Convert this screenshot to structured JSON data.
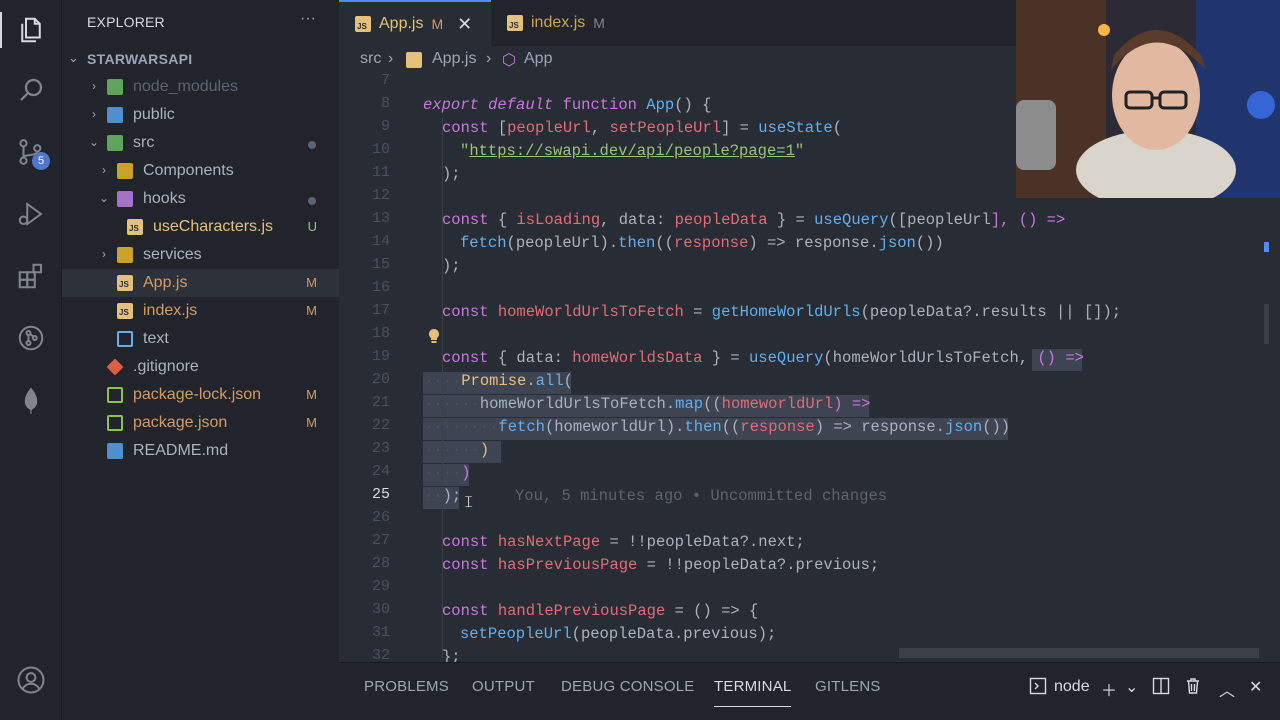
{
  "activity_bar": {
    "items": [
      {
        "icon": "files-icon"
      },
      {
        "icon": "search-icon"
      },
      {
        "icon": "source-control-icon",
        "badge": "5"
      },
      {
        "icon": "run-debug-icon"
      },
      {
        "icon": "extensions-icon"
      },
      {
        "icon": "gitlens-icon"
      },
      {
        "icon": "mongodb-leaf-icon"
      }
    ],
    "bottom": {
      "icon": "account-icon"
    }
  },
  "sidebar": {
    "title": "EXPLORER",
    "more": "···",
    "root": "STARWARSAPI",
    "tree": [
      {
        "name": "node_modules",
        "chevron": "›",
        "status": ""
      },
      {
        "name": "public",
        "chevron": "›",
        "status": ""
      },
      {
        "name": "src",
        "chevron": "⌄",
        "status": "dot"
      },
      {
        "name": "Components",
        "chevron": "›",
        "status": ""
      },
      {
        "name": "hooks",
        "chevron": "⌄",
        "status": "dot"
      },
      {
        "name": "useCharacters.js",
        "chevron": "",
        "status": "U"
      },
      {
        "name": "services",
        "chevron": "›",
        "status": ""
      },
      {
        "name": "App.js",
        "chevron": "",
        "status": "M"
      },
      {
        "name": "index.js",
        "chevron": "",
        "status": "M"
      },
      {
        "name": "text",
        "chevron": "",
        "status": ""
      },
      {
        "name": ".gitignore",
        "chevron": "",
        "status": ""
      },
      {
        "name": "package-lock.json",
        "chevron": "",
        "status": "M"
      },
      {
        "name": "package.json",
        "chevron": "",
        "status": "M"
      },
      {
        "name": "README.md",
        "chevron": "",
        "status": ""
      }
    ]
  },
  "tabs": [
    {
      "label": "App.js",
      "status": "M",
      "close": "✕",
      "active": true
    },
    {
      "label": "index.js",
      "status": "M",
      "active": false
    }
  ],
  "breadcrumb": {
    "part1": "src",
    "sep": "›",
    "part2": "App.js",
    "part3": "App"
  },
  "editor": {
    "line_numbers": [
      "7",
      "8",
      "9",
      "10",
      "11",
      "12",
      "13",
      "14",
      "15",
      "16",
      "17",
      "18",
      "19",
      "20",
      "21",
      "22",
      "23",
      "24",
      "25",
      "26",
      "27",
      "28",
      "29",
      "30",
      "31",
      "32"
    ],
    "current_line": "25",
    "blame": "You, 5 minutes ago • Uncommitted changes",
    "tokens": {
      "l8": [
        "export",
        " ",
        "default",
        " ",
        "function",
        " ",
        "App",
        "() {"
      ],
      "l9": [
        "const",
        " [",
        "peopleUrl",
        ", ",
        "setPeopleUrl",
        "] = ",
        "useState",
        "("
      ],
      "l10": [
        "\"",
        "https://swapi.dev/api/people?page=1",
        "\""
      ],
      "l11": [
        ");"
      ],
      "l13": [
        "const",
        " { ",
        "isLoading",
        ", ",
        "data",
        ": ",
        "peopleData",
        " } = ",
        "useQuery",
        "([",
        "peopleUrl",
        "], () =>"
      ],
      "l14": [
        "fetch",
        "(",
        "peopleUrl",
        ").",
        "then",
        "((",
        "response",
        ") => ",
        "response",
        ".",
        "json",
        "())"
      ],
      "l15": [
        ");"
      ],
      "l17": [
        "const",
        " ",
        "homeWorldUrlsToFetch",
        " = ",
        "getHomeWorldUrls",
        "(",
        "peopleData",
        "?.",
        "results",
        " || ",
        "[]",
        ");"
      ],
      "l19": [
        "const",
        " { ",
        "data",
        ": ",
        "homeWorldsData",
        " } = ",
        "useQuery",
        "(",
        "homeWorldUrlsToFetch",
        ", ",
        "() =>"
      ],
      "l20": [
        "····",
        "Promise",
        ".",
        "all",
        "("
      ],
      "l21": [
        "······",
        "homeWorldUrlsToFetch",
        ".",
        "map",
        "((",
        "homeworldUrl",
        ") =>"
      ],
      "l22": [
        "········",
        "fetch",
        "(",
        "homeworldUrl",
        ").",
        "then",
        "((",
        "response",
        ") => ",
        "response",
        ".",
        "json",
        "())"
      ],
      "l23": [
        "······",
        ")"
      ],
      "l24": [
        "····",
        ")"
      ],
      "l25": [
        "··",
        ");"
      ],
      "l27": [
        "const",
        " ",
        "hasNextPage",
        " = !!",
        "peopleData",
        "?.",
        "next",
        ";"
      ],
      "l28": [
        "const",
        " ",
        "hasPreviousPage",
        " = !!",
        "peopleData",
        "?.",
        "previous",
        ";"
      ],
      "l30": [
        "const",
        " ",
        "handlePreviousPage",
        " = () => {"
      ],
      "l31": [
        "setPeopleUrl",
        "(",
        "peopleData",
        ".",
        "previous",
        ");"
      ],
      "l32": [
        "};"
      ]
    }
  },
  "panel": {
    "tabs": [
      "PROBLEMS",
      "OUTPUT",
      "DEBUG CONSOLE",
      "TERMINAL",
      "GITLENS"
    ],
    "active_tab": "TERMINAL",
    "terminal_name": "node",
    "controls": [
      "terminal-icon",
      "plus-icon",
      "chevron-down-icon",
      "split-icon",
      "trash-icon",
      "chevron-up-icon",
      "close-icon"
    ]
  },
  "colors": {
    "editor_bg": "#282c34",
    "sidebar_bg": "#21252b",
    "accent": "#528bff",
    "keyword": "#c678dd",
    "function": "#61afef",
    "variable": "#e06c75",
    "string": "#98c379",
    "modified": "#d19a66"
  }
}
